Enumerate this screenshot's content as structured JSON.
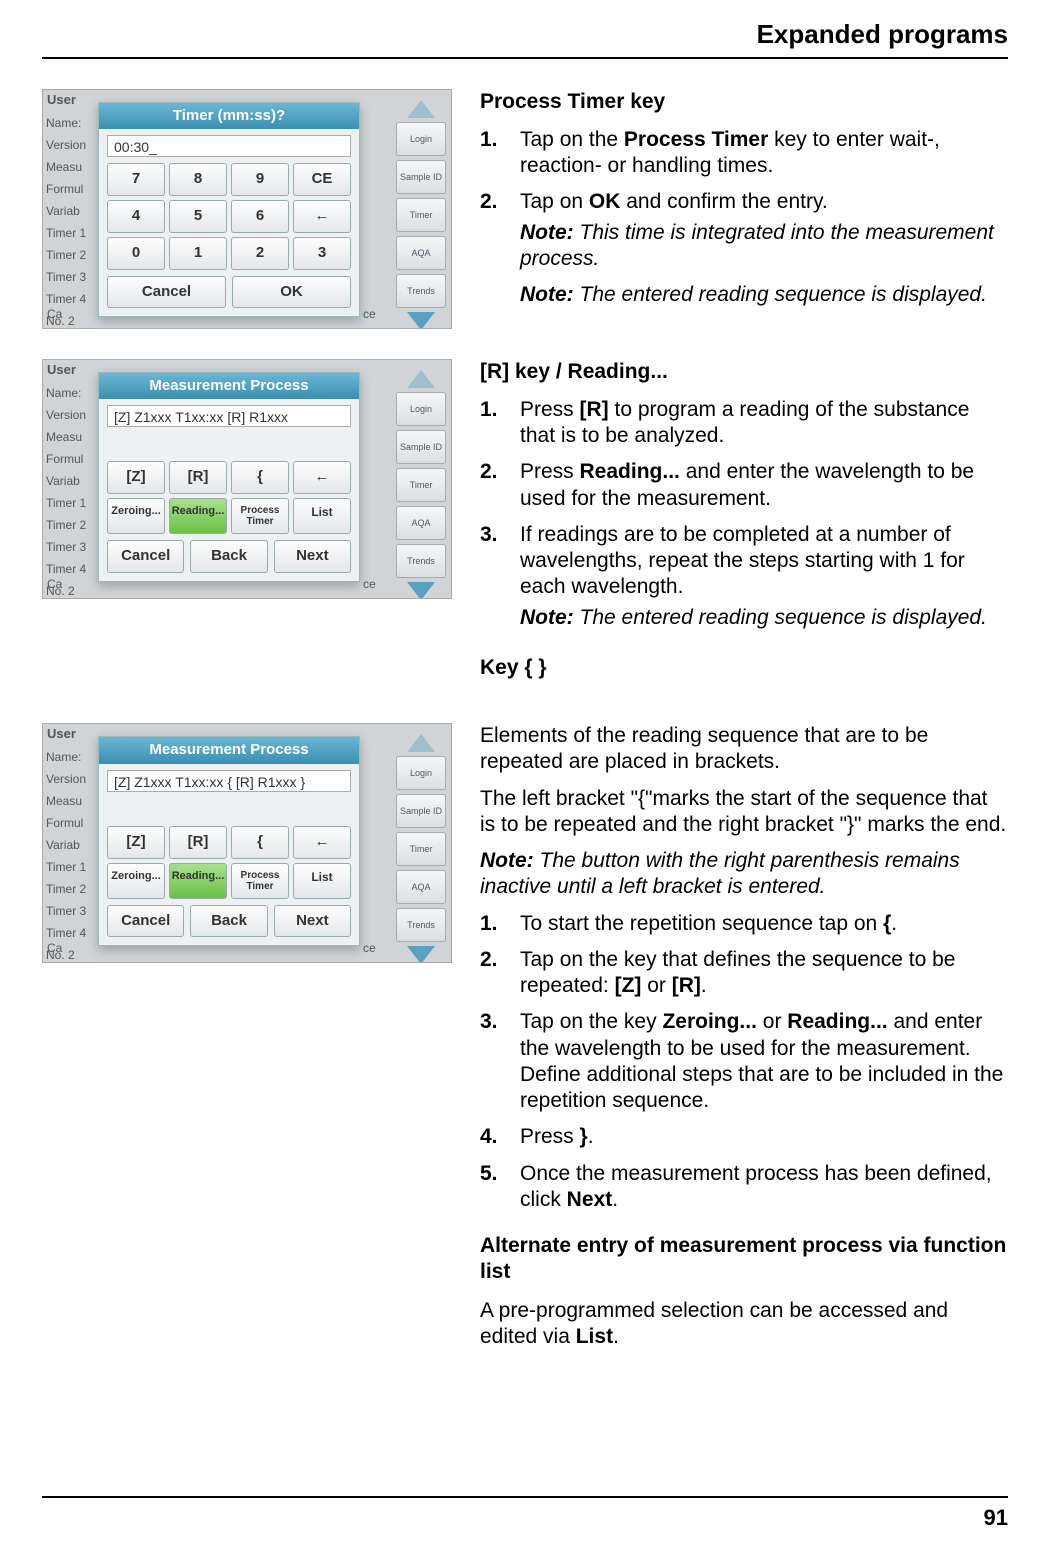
{
  "header": {
    "title": "Expanded programs"
  },
  "footer": {
    "page": "91"
  },
  "shot_common": {
    "user": "User",
    "left_labels": [
      "Name:",
      "Version",
      "Measu",
      "Formul",
      "Variab",
      "Timer 1",
      "Timer 2",
      "Timer 3",
      "Timer 4",
      "No. 2"
    ],
    "side_buttons": [
      "Login",
      "Sample ID",
      "Timer",
      "AQA",
      "Trends"
    ],
    "bottom_ca": "Ca",
    "bottom_ce": "ce"
  },
  "shot1": {
    "title": "Timer (mm:ss)?",
    "field": "00:30_",
    "keys": [
      "7",
      "8",
      "9",
      "CE",
      "4",
      "5",
      "6",
      "←",
      "0",
      "1",
      "2",
      "3"
    ],
    "cancel": "Cancel",
    "ok": "OK"
  },
  "shot2": {
    "title": "Measurement Process",
    "field": "[Z] Z1xxx T1xx:xx [R] R1xxx",
    "row1": [
      "[Z]",
      "[R]",
      "{",
      "←"
    ],
    "row2": [
      "Zeroing...",
      "Reading...",
      "Process Timer",
      "List"
    ],
    "row3": [
      "Cancel",
      "Back",
      "Next"
    ]
  },
  "shot3": {
    "title": "Measurement Process",
    "field": "[Z] Z1xxx T1xx:xx { [R] R1xxx  }",
    "row1": [
      "[Z]",
      "[R]",
      "{",
      "←"
    ],
    "row2": [
      "Zeroing...",
      "Reading...",
      "Process Timer",
      "List"
    ],
    "row3": [
      "Cancel",
      "Back",
      "Next"
    ]
  },
  "sec1": {
    "heading": "Process Timer key",
    "items": [
      {
        "n": "1.",
        "pre": "Tap on the ",
        "b1": "Process Timer",
        "post": " key to enter wait-, reaction- or handling times."
      },
      {
        "n": "2.",
        "pre": "Tap on ",
        "b1": "OK",
        "post": " and confirm the entry."
      }
    ],
    "note1_label": "Note:",
    "note1": " This time is integrated into the measurement process.",
    "note2_label": "Note:",
    "note2": " The entered reading sequence is displayed."
  },
  "sec2": {
    "heading": "[R] key / Reading...",
    "items": [
      {
        "n": "1.",
        "pre": "Press  ",
        "b1": "[R]",
        "post": "  to program a reading of the substance that is to be analyzed."
      },
      {
        "n": "2.",
        "pre": "Press ",
        "b1": "Reading...",
        "post": " and enter the wavelength to be used for the measurement."
      },
      {
        "n": "3.",
        "pre": "If readings are to be completed at a number of wavelengths, repeat the steps starting with 1 for each wavelength.",
        "b1": "",
        "post": ""
      }
    ],
    "note_label": "Note:",
    "note": " The entered reading sequence is displayed."
  },
  "sec3": {
    "heading": "Key { }",
    "p1": "Elements of the reading sequence that are to be repeated are placed in brackets.",
    "p2": "The left bracket \"{\"marks the start of the sequence that is to be repeated and the right bracket \"}\" marks the end.",
    "note_label": "Note:",
    "note": " The button with the right parenthesis remains inactive until a left bracket is entered.",
    "items": [
      {
        "n": "1.",
        "pre": "To start the repetition sequence tap on ",
        "b1": "{",
        "post": "."
      },
      {
        "n": "2.",
        "pre": "Tap on the key that defines the sequence to be repeated: ",
        "b1": "[Z]",
        "mid": " or ",
        "b2": "[R]",
        "post": "."
      },
      {
        "n": "3.",
        "pre": "Tap on the key ",
        "b1": "Zeroing...",
        "mid": " or ",
        "b2": "Reading...",
        "post": " and enter the wavelength to be used for the measurement. Define additional steps that are to be included in the repetition sequence."
      },
      {
        "n": "4.",
        "pre": "Press ",
        "b1": "}",
        "post": "."
      },
      {
        "n": "5.",
        "pre": "Once the measurement process has been defined, click ",
        "b1": "Next",
        "post": "."
      }
    ]
  },
  "sec4": {
    "heading": "Alternate entry of measurement process via function list",
    "p1a": "A pre-programmed selection can be accessed and edited via ",
    "p1b": "List",
    "p1c": "."
  }
}
